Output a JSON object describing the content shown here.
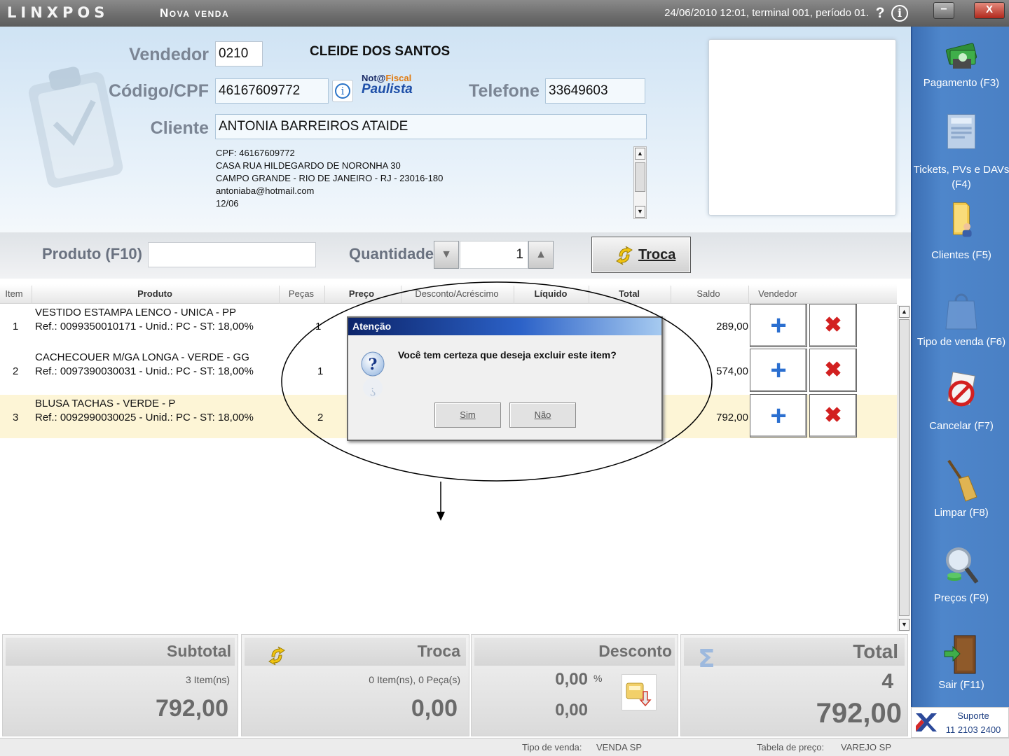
{
  "titlebar": {
    "logo": "LINXPOS",
    "screen_title": "Nova venda",
    "status": "24/06/2010 12:01, terminal 001, período 01.",
    "help_icon": "question-icon",
    "info_icon": "info-icon",
    "minimize": "−",
    "close": "X"
  },
  "customer": {
    "seller_label": "Vendedor",
    "seller_code": "0210",
    "seller_name": "CLEIDE DOS SANTOS",
    "cpf_label": "Código/CPF",
    "cpf_value": "46167609772",
    "nfp_logo_line1": "Not@",
    "nfp_logo_line1_accent": "Fiscal",
    "nfp_logo_line2": "Paulista",
    "phone_label": "Telefone",
    "phone_value": "33649603",
    "client_label": "Cliente",
    "client_name": "ANTONIA BARREIROS ATAIDE",
    "details": [
      "CPF: 46167609772",
      "CASA RUA HILDEGARDO DE NORONHA 30",
      "CAMPO GRANDE - RIO DE JANEIRO - RJ - 23016-180",
      "antoniaba@hotmail.com",
      "12/06"
    ]
  },
  "entry": {
    "product_label": "Produto (F10)",
    "product_value": "",
    "quantity_label": "Quantidade",
    "quantity_value": "1",
    "exchange_button": "Troca"
  },
  "table": {
    "columns": [
      "Item",
      "Produto",
      "Peças",
      "Preço",
      "Desconto/Acréscimo",
      "Líquido",
      "Total",
      "Saldo",
      "Vendedor"
    ],
    "rows": [
      {
        "item": "1",
        "name": "VESTIDO ESTAMPA LENCO - UNICA - PP",
        "ref": "Ref.: 0099350010171 - Unid.: PC - ST: 18,00%",
        "pieces": "1",
        "balance": "289,00"
      },
      {
        "item": "2",
        "name": "CACHECOUER M/GA LONGA - VERDE - GG",
        "ref": "Ref.: 0097390030031 - Unid.: PC - ST: 18,00%",
        "pieces": "1",
        "balance": "574,00"
      },
      {
        "item": "3",
        "name": "BLUSA TACHAS - VERDE - P",
        "ref": "Ref.: 0092990030025 - Unid.: PC - ST: 18,00%",
        "pieces": "2",
        "balance": "792,00"
      }
    ],
    "add_symbol": "+",
    "delete_symbol": "✖"
  },
  "dialog": {
    "title": "Atenção",
    "message": "Você tem certeza que deseja excluir este item?",
    "yes": "Sim",
    "no": "Não"
  },
  "summary": {
    "subtotal_title": "Subtotal",
    "subtotal_items": "3 Item(ns)",
    "subtotal_value": "792,00",
    "exchange_title": "Troca",
    "exchange_items": "0 Item(ns), 0 Peça(s)",
    "exchange_value": "0,00",
    "discount_title": "Desconto",
    "discount_percent": "0,00",
    "discount_percent_sign": "%",
    "discount_value": "0,00",
    "total_title": "Total",
    "total_count": "4",
    "total_value": "792,00"
  },
  "sidebar": {
    "items": [
      {
        "label": "Pagamento (F3)",
        "icon": "money-icon"
      },
      {
        "label": "Tickets, PVs e DAVs (F4)",
        "icon": "tickets-icon"
      },
      {
        "label": "Clientes (F5)",
        "icon": "clients-folder-icon"
      },
      {
        "label": "Tipo de venda (F6)",
        "icon": "shopping-bag-icon"
      },
      {
        "label": "Cancelar (F7)",
        "icon": "cancel-icon"
      },
      {
        "label": "Limpar (F8)",
        "icon": "broom-icon"
      },
      {
        "label": "Preços (F9)",
        "icon": "price-search-icon"
      },
      {
        "label": "Sair (F11)",
        "icon": "exit-door-icon"
      }
    ],
    "support_title": "Suporte",
    "support_phone": "11 2103 2400"
  },
  "statusbar": {
    "sale_type_label": "Tipo de venda:",
    "sale_type_value": "VENDA SP",
    "price_table_label": "Tabela de preço:",
    "price_table_value": "VAREJO SP"
  },
  "colors": {
    "sidebar": "#4a80c4",
    "dialog_title": "#0c246a",
    "selected_row": "#fdf5d6",
    "add_button": "#2b6fd0",
    "delete_button": "#d22020"
  }
}
